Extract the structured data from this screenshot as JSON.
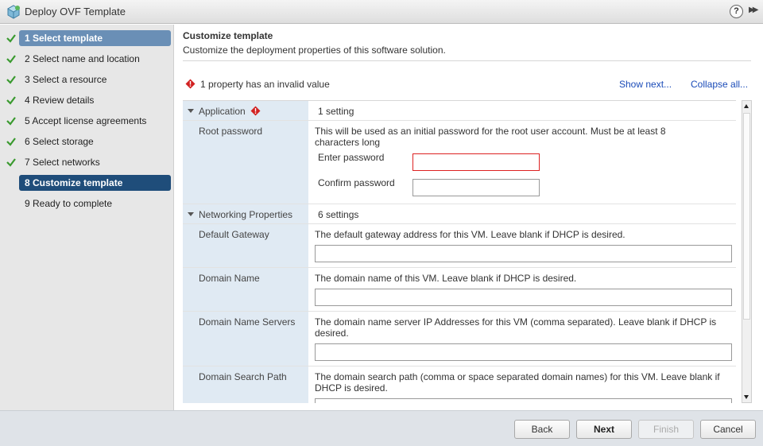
{
  "window": {
    "title": "Deploy OVF Template",
    "help_label": "?",
    "expand_label": "▶▶"
  },
  "sidebar": {
    "steps": [
      {
        "label": "1  Select template",
        "done": true
      },
      {
        "label": "2  Select name and location",
        "done": true
      },
      {
        "label": "3  Select a resource",
        "done": true
      },
      {
        "label": "4  Review details",
        "done": true
      },
      {
        "label": "5  Accept license agreements",
        "done": true
      },
      {
        "label": "6  Select storage",
        "done": true
      },
      {
        "label": "7  Select networks",
        "done": true
      },
      {
        "label": "8  Customize template",
        "done": false
      },
      {
        "label": "9  Ready to complete",
        "done": false
      }
    ]
  },
  "header": {
    "title": "Customize template",
    "subtitle": "Customize the deployment properties of this software solution."
  },
  "validation": {
    "message": "1 property has an invalid value",
    "show_next": "Show next...",
    "collapse_all": "Collapse all..."
  },
  "properties": {
    "application": {
      "label": "Application",
      "count": "1 setting",
      "root_password": {
        "label": "Root password",
        "description": "This will be used as an initial password for the root user account. Must be at least 8 characters long",
        "enter_label": "Enter password",
        "confirm_label": "Confirm password",
        "enter_value": "",
        "confirm_value": ""
      }
    },
    "networking": {
      "label": "Networking Properties",
      "count": "6 settings",
      "default_gateway": {
        "label": "Default Gateway",
        "description": "The default gateway address for this VM. Leave blank if DHCP is desired.",
        "value": ""
      },
      "domain_name": {
        "label": "Domain Name",
        "description": "The domain name of this VM. Leave blank if DHCP is desired.",
        "value": ""
      },
      "domain_name_servers": {
        "label": "Domain Name Servers",
        "description": "The domain name server IP Addresses for this VM (comma separated). Leave blank if DHCP is desired.",
        "value": ""
      },
      "domain_search_path": {
        "label": "Domain Search Path",
        "description": "The domain search path (comma or space separated domain names) for this VM. Leave blank if DHCP is desired.",
        "value": ""
      }
    }
  },
  "footer": {
    "back": "Back",
    "next": "Next",
    "finish": "Finish",
    "cancel": "Cancel"
  },
  "colors": {
    "selected_step": "#1f4d7a",
    "first_step": "#6a8fb6",
    "label_cell": "#e0eaf3",
    "error": "#d22222",
    "link": "#1a4bb8",
    "check": "#3a9a2f"
  }
}
